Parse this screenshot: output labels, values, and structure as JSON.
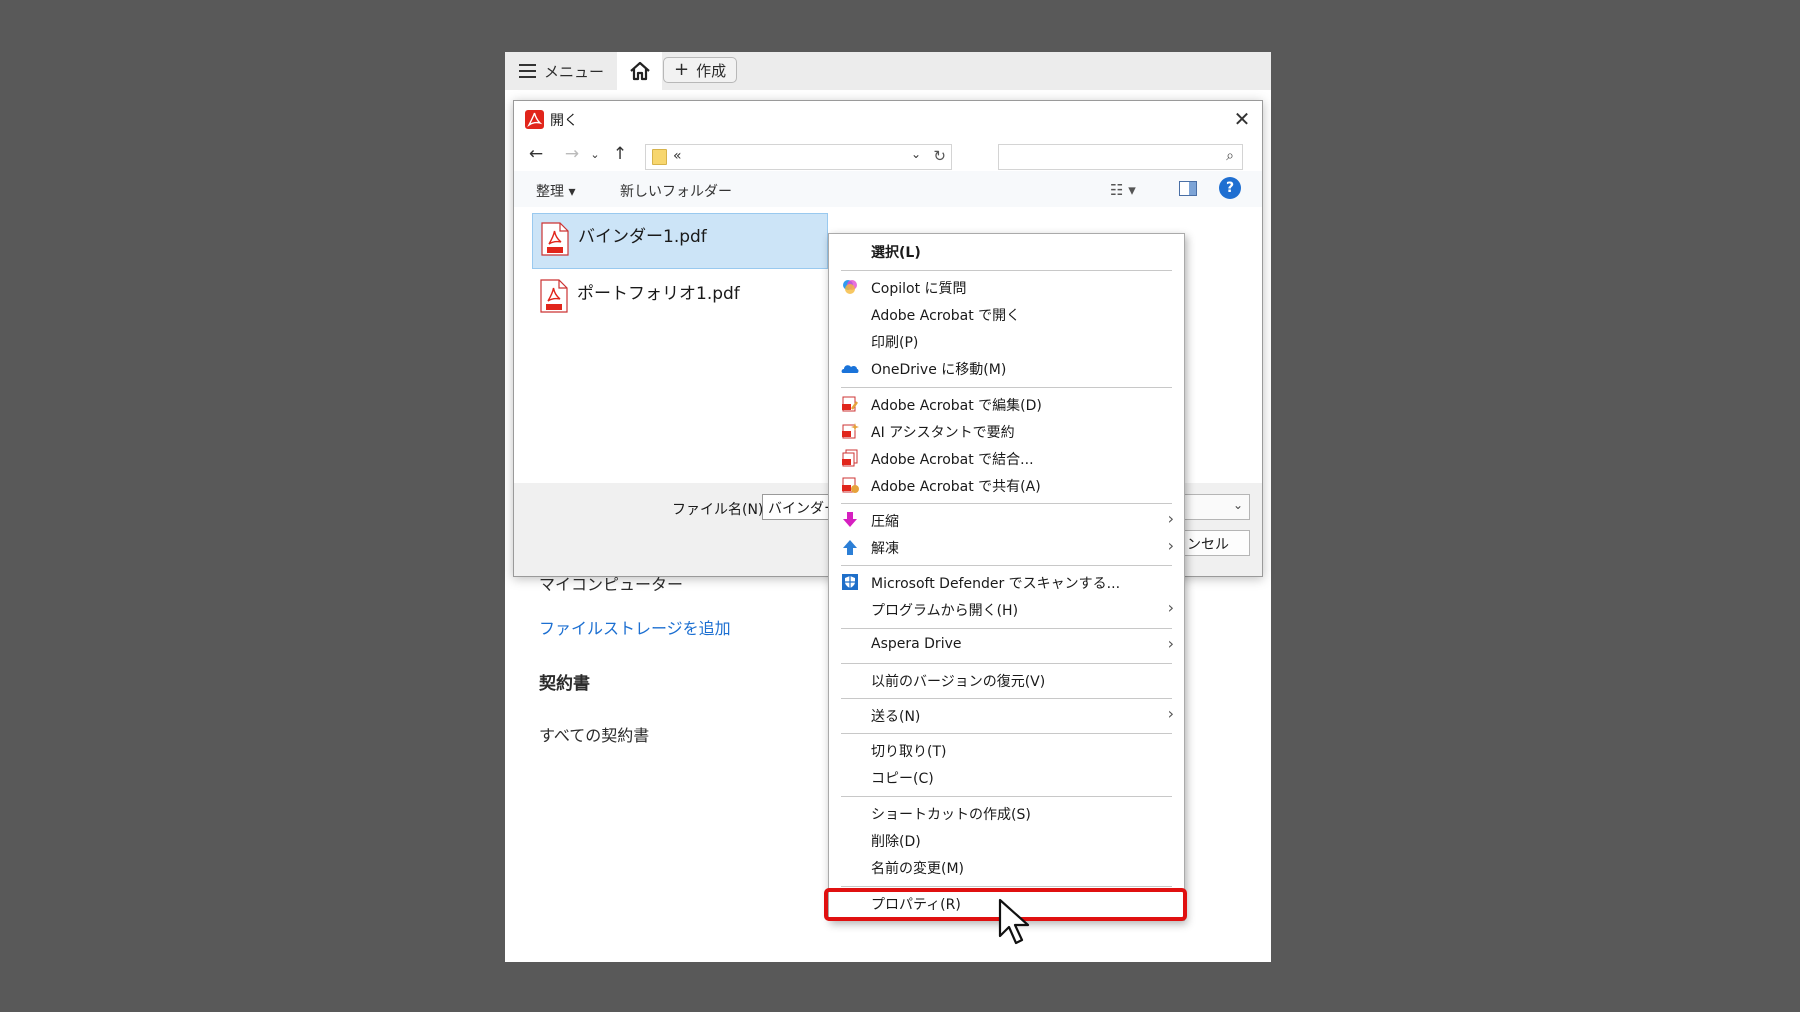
{
  "app": {
    "menu_label": "メニュー",
    "create_label": "作成",
    "sidebar": {
      "computer": "マイコンピューター",
      "add_storage": "ファイルストレージを追加",
      "contracts_heading": "契約書",
      "all_contracts": "すべての契約書"
    }
  },
  "dialog": {
    "title": "開く",
    "address_path": "«",
    "organize_label": "整理 ▾",
    "new_folder_label": "新しいフォルダー",
    "files": [
      {
        "name": "バインダー1.pdf",
        "selected": true
      },
      {
        "name": "ポートフォリオ1.pdf",
        "selected": false
      }
    ],
    "filename_label": "ファイル名(N):",
    "filename_value": "バインダー1",
    "cancel_label": "キャンセル"
  },
  "context_menu": {
    "items": [
      {
        "label": "選択(L)",
        "bold": true,
        "icon": "none"
      },
      {
        "label": "Copilot に質問",
        "icon": "copilot-icon"
      },
      {
        "label": "Adobe Acrobat で開く",
        "icon": "none"
      },
      {
        "label": "印刷(P)",
        "icon": "none"
      },
      {
        "label": "OneDrive に移動(M)",
        "icon": "onedrive-icon"
      },
      {
        "label": "Adobe Acrobat で編集(D)",
        "icon": "acrobat-edit-icon"
      },
      {
        "label": "AI アシスタントで要約",
        "icon": "acrobat-ai-icon"
      },
      {
        "label": "Adobe Acrobat で結合...",
        "icon": "acrobat-combine-icon"
      },
      {
        "label": "Adobe Acrobat で共有(A)",
        "icon": "acrobat-share-icon"
      },
      {
        "label": "圧縮",
        "icon": "compress-icon",
        "submenu": true
      },
      {
        "label": "解凍",
        "icon": "extract-icon",
        "submenu": true
      },
      {
        "label": "Microsoft Defender でスキャンする...",
        "icon": "defender-icon"
      },
      {
        "label": "プログラムから開く(H)",
        "icon": "none",
        "submenu": true
      },
      {
        "label": "Aspera Drive",
        "icon": "none",
        "submenu": true
      },
      {
        "label": "以前のバージョンの復元(V)",
        "icon": "none"
      },
      {
        "label": "送る(N)",
        "icon": "none",
        "submenu": true
      },
      {
        "label": "切り取り(T)",
        "icon": "none"
      },
      {
        "label": "コピー(C)",
        "icon": "none"
      },
      {
        "label": "ショートカットの作成(S)",
        "icon": "none"
      },
      {
        "label": "削除(D)",
        "icon": "none"
      },
      {
        "label": "名前の変更(M)",
        "icon": "none"
      },
      {
        "label": "プロパティ(R)",
        "icon": "none",
        "highlighted": true
      }
    ]
  },
  "colors": {
    "backdrop": "#595959",
    "selection": "#cce4f7",
    "highlight_box": "#e01010",
    "link": "#1c6fd1",
    "acrobat_red": "#e1251b"
  }
}
